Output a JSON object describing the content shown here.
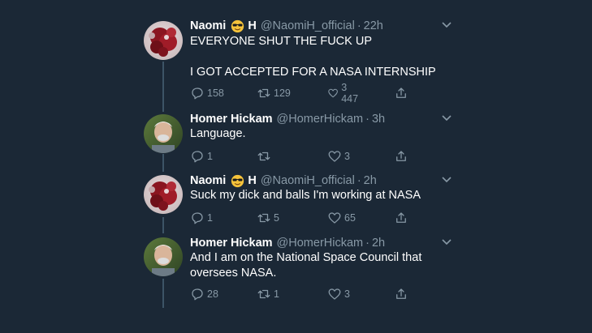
{
  "tweets": [
    {
      "name": "Naomi",
      "emoji": "sunglasses-emoji",
      "name_suffix": "H",
      "handle": "@NaomiH_official",
      "dot": "·",
      "time": "22h",
      "lines": [
        "EVERYONE SHUT THE FUCK UP",
        "",
        "I GOT ACCEPTED FOR A NASA INTERNSHIP"
      ],
      "replies": "158",
      "retweets": "129",
      "likes": "3 447"
    },
    {
      "name": "Homer Hickam",
      "emoji": "",
      "name_suffix": "",
      "handle": "@HomerHickam",
      "dot": "·",
      "time": "3h",
      "lines": [
        "Language."
      ],
      "replies": "1",
      "retweets": "",
      "likes": "3"
    },
    {
      "name": "Naomi",
      "emoji": "sunglasses-emoji",
      "name_suffix": "H",
      "handle": "@NaomiH_official",
      "dot": "·",
      "time": "2h",
      "lines": [
        "Suck my dick and balls I'm working at NASA"
      ],
      "replies": "1",
      "retweets": "5",
      "likes": "65"
    },
    {
      "name": "Homer Hickam",
      "emoji": "",
      "name_suffix": "",
      "handle": "@HomerHickam",
      "dot": "·",
      "time": "2h",
      "lines": [
        "And I am on the National Space Council that",
        "oversees NASA."
      ],
      "replies": "28",
      "retweets": "1",
      "likes": "3"
    }
  ],
  "colors": {
    "background": "#1b2836",
    "text": "#ffffff",
    "secondary": "#8899a6",
    "thread_line": "#3d5466"
  },
  "icons": {
    "reply": "reply-icon",
    "retweet": "retweet-icon",
    "like": "like-icon",
    "share": "share-icon",
    "more": "chevron-down-icon"
  }
}
